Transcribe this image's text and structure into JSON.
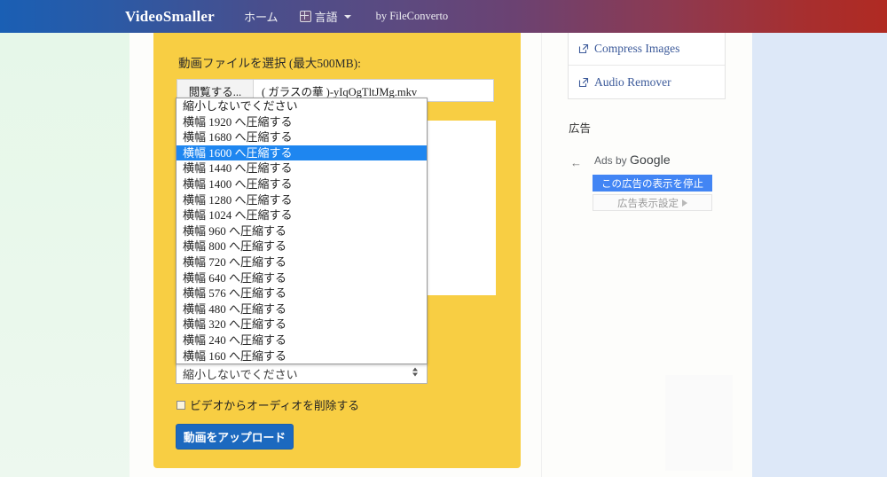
{
  "navbar": {
    "brand": "VideoSmaller",
    "home_label": "ホーム",
    "language_label": "言語",
    "byline": "by FileConverto"
  },
  "form": {
    "file_label": "動画ファイルを選択 (最大500MB):",
    "browse_button": "閲覧する...",
    "file_name": "( ガラスの華 )-yIqOgTltJMg.mkv",
    "select_value": "縮小しないでください",
    "audio_checkbox_label": "ビデオからオーディオを削除する",
    "upload_button": "動画をアップロード",
    "options": [
      "縮小しないでください",
      "横幅 1920 へ圧縮する",
      "横幅 1680 へ圧縮する",
      "横幅 1600 へ圧縮する",
      "横幅 1440 へ圧縮する",
      "横幅 1400 へ圧縮する",
      "横幅 1280 へ圧縮する",
      "横幅 1024 へ圧縮する",
      "横幅 960 へ圧縮する",
      "横幅 800 へ圧縮する",
      "横幅 720 へ圧縮する",
      "横幅 640 へ圧縮する",
      "横幅 576 へ圧縮する",
      "横幅 480 へ圧縮する",
      "横幅 320 へ圧縮する",
      "横幅 240 へ圧縮する",
      "横幅 160 へ圧縮する"
    ],
    "selected_option_index": 3
  },
  "sidebar": {
    "tools": [
      {
        "label": "Compress Images",
        "icon": "external-link-icon"
      },
      {
        "label": "Audio Remover",
        "icon": "external-link-icon"
      }
    ],
    "ads_label": "広告"
  },
  "ad": {
    "ads_by": "Ads by ",
    "ads_by_brand": "Google",
    "stop_button": "この広告の表示を停止",
    "settings_button": "広告表示設定",
    "back_arrow": "←"
  },
  "colors": {
    "card_yellow": "#f8ce43",
    "primary_blue": "#1c69bf",
    "highlight_blue": "#1e86f0",
    "ad_blue": "#4285f4",
    "panel_left_green": "#e8f7ea",
    "panel_right_blue": "#dde8f8"
  }
}
